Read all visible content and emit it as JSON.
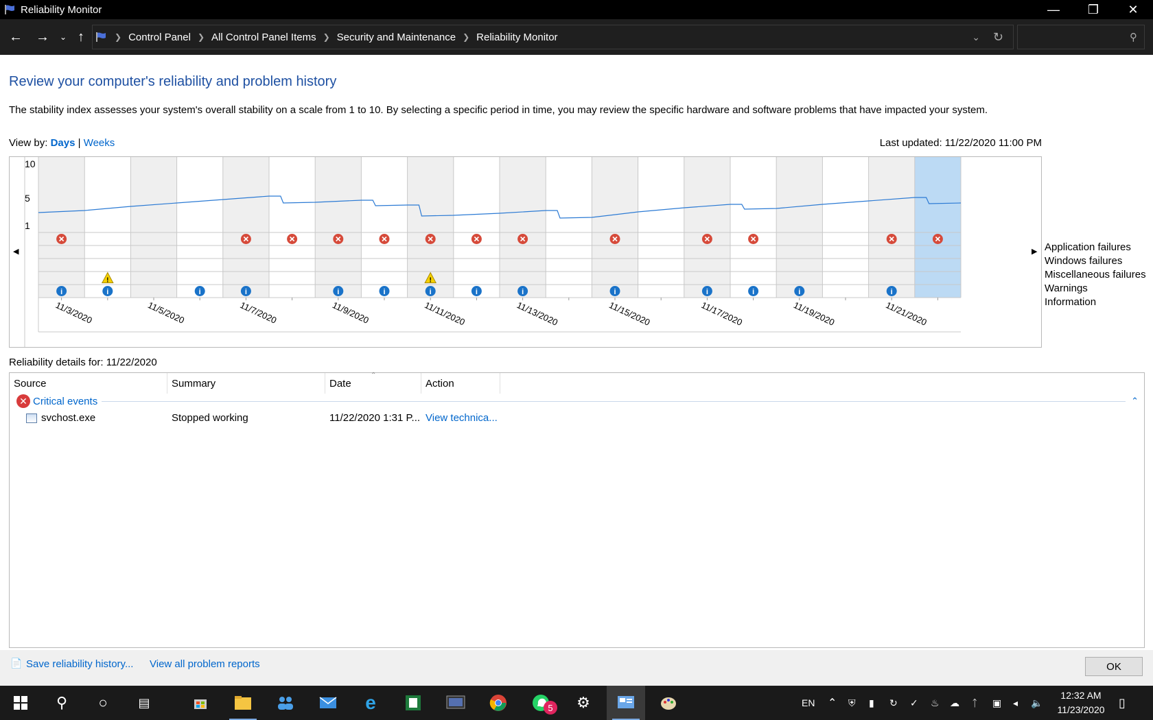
{
  "window": {
    "title": "Reliability Monitor"
  },
  "address": {
    "breadcrumbs": [
      "Control Panel",
      "All Control Panel Items",
      "Security and Maintenance",
      "Reliability Monitor"
    ],
    "search_placeholder": ""
  },
  "main": {
    "heading": "Review your computer's reliability and problem history",
    "description": "The stability index assesses your system's overall stability on a scale from 1 to 10. By selecting a specific period in time, you may review the specific hardware and software problems that have impacted your system.",
    "view_by_label": "View by:",
    "view_days": "Days",
    "view_sep": "|",
    "view_weeks": "Weeks",
    "last_updated": "Last updated: 11/22/2020 11:00 PM"
  },
  "chart_data": {
    "type": "line",
    "title": "",
    "y_ticks": [
      "10",
      "5",
      "1"
    ],
    "ylim": [
      1,
      10
    ],
    "dates": [
      "11/3/2020",
      "11/4/2020",
      "11/5/2020",
      "11/6/2020",
      "11/7/2020",
      "11/8/2020",
      "11/9/2020",
      "11/10/2020",
      "11/11/2020",
      "11/12/2020",
      "11/13/2020",
      "11/14/2020",
      "11/15/2020",
      "11/16/2020",
      "11/17/2020",
      "11/18/2020",
      "11/19/2020",
      "11/20/2020",
      "11/21/2020",
      "11/22/2020"
    ],
    "x_tick_labels": [
      "11/3/2020",
      "11/5/2020",
      "11/7/2020",
      "11/9/2020",
      "11/11/2020",
      "11/13/2020",
      "11/15/2020",
      "11/17/2020",
      "11/19/2020",
      "11/21/2020"
    ],
    "series": [
      {
        "values": [
          3.2,
          3.8,
          4.3,
          4.8,
          5.3,
          4.4,
          4.7,
          4.0,
          2.5,
          2.8,
          3.2,
          2.2,
          3.0,
          3.6,
          4.1,
          3.5,
          4.1,
          4.6,
          5.1,
          4.3
        ]
      }
    ],
    "selected_date": "11/22/2020",
    "event_rows": [
      "Application failures",
      "Windows failures",
      "Miscellaneous failures",
      "Warnings",
      "Information"
    ],
    "application_failures": [
      1,
      0,
      0,
      0,
      1,
      1,
      1,
      1,
      1,
      1,
      1,
      0,
      1,
      0,
      1,
      1,
      0,
      0,
      1,
      1
    ],
    "windows_failures": [
      0,
      0,
      0,
      0,
      0,
      0,
      0,
      0,
      0,
      0,
      0,
      0,
      0,
      0,
      0,
      0,
      0,
      0,
      0,
      0
    ],
    "miscellaneous_failures": [
      0,
      0,
      0,
      0,
      0,
      0,
      0,
      0,
      0,
      0,
      0,
      0,
      0,
      0,
      0,
      0,
      0,
      0,
      0,
      0
    ],
    "warnings": [
      0,
      1,
      0,
      0,
      0,
      0,
      0,
      0,
      1,
      0,
      0,
      0,
      0,
      0,
      0,
      0,
      0,
      0,
      0,
      0
    ],
    "information": [
      1,
      1,
      0,
      1,
      1,
      0,
      1,
      1,
      1,
      1,
      1,
      0,
      1,
      0,
      1,
      1,
      1,
      0,
      1,
      0
    ]
  },
  "details": {
    "label": "Reliability details for: 11/22/2020",
    "columns": [
      "Source",
      "Summary",
      "Date",
      "Action"
    ],
    "group_label": "Critical events",
    "rows": [
      {
        "source": "svchost.exe",
        "summary": "Stopped working",
        "date": "11/22/2020 1:31 P...",
        "action": "View technica..."
      }
    ]
  },
  "footer": {
    "save_link": "Save reliability history...",
    "problems_link": "View all problem reports",
    "ok_label": "OK"
  },
  "taskbar": {
    "language": "EN",
    "time": "12:32 AM",
    "date": "11/23/2020",
    "whatsapp_badge": "5"
  }
}
